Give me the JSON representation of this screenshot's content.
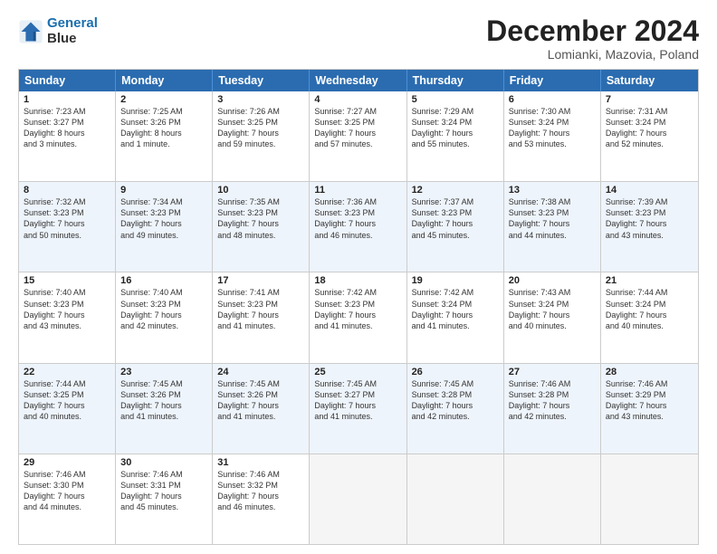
{
  "logo": {
    "line1": "General",
    "line2": "Blue"
  },
  "title": "December 2024",
  "location": "Lomianki, Mazovia, Poland",
  "days": [
    "Sunday",
    "Monday",
    "Tuesday",
    "Wednesday",
    "Thursday",
    "Friday",
    "Saturday"
  ],
  "rows": [
    [
      {
        "day": "1",
        "text": "Sunrise: 7:23 AM\nSunset: 3:27 PM\nDaylight: 8 hours\nand 3 minutes."
      },
      {
        "day": "2",
        "text": "Sunrise: 7:25 AM\nSunset: 3:26 PM\nDaylight: 8 hours\nand 1 minute."
      },
      {
        "day": "3",
        "text": "Sunrise: 7:26 AM\nSunset: 3:25 PM\nDaylight: 7 hours\nand 59 minutes."
      },
      {
        "day": "4",
        "text": "Sunrise: 7:27 AM\nSunset: 3:25 PM\nDaylight: 7 hours\nand 57 minutes."
      },
      {
        "day": "5",
        "text": "Sunrise: 7:29 AM\nSunset: 3:24 PM\nDaylight: 7 hours\nand 55 minutes."
      },
      {
        "day": "6",
        "text": "Sunrise: 7:30 AM\nSunset: 3:24 PM\nDaylight: 7 hours\nand 53 minutes."
      },
      {
        "day": "7",
        "text": "Sunrise: 7:31 AM\nSunset: 3:24 PM\nDaylight: 7 hours\nand 52 minutes."
      }
    ],
    [
      {
        "day": "8",
        "text": "Sunrise: 7:32 AM\nSunset: 3:23 PM\nDaylight: 7 hours\nand 50 minutes."
      },
      {
        "day": "9",
        "text": "Sunrise: 7:34 AM\nSunset: 3:23 PM\nDaylight: 7 hours\nand 49 minutes."
      },
      {
        "day": "10",
        "text": "Sunrise: 7:35 AM\nSunset: 3:23 PM\nDaylight: 7 hours\nand 48 minutes."
      },
      {
        "day": "11",
        "text": "Sunrise: 7:36 AM\nSunset: 3:23 PM\nDaylight: 7 hours\nand 46 minutes."
      },
      {
        "day": "12",
        "text": "Sunrise: 7:37 AM\nSunset: 3:23 PM\nDaylight: 7 hours\nand 45 minutes."
      },
      {
        "day": "13",
        "text": "Sunrise: 7:38 AM\nSunset: 3:23 PM\nDaylight: 7 hours\nand 44 minutes."
      },
      {
        "day": "14",
        "text": "Sunrise: 7:39 AM\nSunset: 3:23 PM\nDaylight: 7 hours\nand 43 minutes."
      }
    ],
    [
      {
        "day": "15",
        "text": "Sunrise: 7:40 AM\nSunset: 3:23 PM\nDaylight: 7 hours\nand 43 minutes."
      },
      {
        "day": "16",
        "text": "Sunrise: 7:40 AM\nSunset: 3:23 PM\nDaylight: 7 hours\nand 42 minutes."
      },
      {
        "day": "17",
        "text": "Sunrise: 7:41 AM\nSunset: 3:23 PM\nDaylight: 7 hours\nand 41 minutes."
      },
      {
        "day": "18",
        "text": "Sunrise: 7:42 AM\nSunset: 3:23 PM\nDaylight: 7 hours\nand 41 minutes."
      },
      {
        "day": "19",
        "text": "Sunrise: 7:42 AM\nSunset: 3:24 PM\nDaylight: 7 hours\nand 41 minutes."
      },
      {
        "day": "20",
        "text": "Sunrise: 7:43 AM\nSunset: 3:24 PM\nDaylight: 7 hours\nand 40 minutes."
      },
      {
        "day": "21",
        "text": "Sunrise: 7:44 AM\nSunset: 3:24 PM\nDaylight: 7 hours\nand 40 minutes."
      }
    ],
    [
      {
        "day": "22",
        "text": "Sunrise: 7:44 AM\nSunset: 3:25 PM\nDaylight: 7 hours\nand 40 minutes."
      },
      {
        "day": "23",
        "text": "Sunrise: 7:45 AM\nSunset: 3:26 PM\nDaylight: 7 hours\nand 41 minutes."
      },
      {
        "day": "24",
        "text": "Sunrise: 7:45 AM\nSunset: 3:26 PM\nDaylight: 7 hours\nand 41 minutes."
      },
      {
        "day": "25",
        "text": "Sunrise: 7:45 AM\nSunset: 3:27 PM\nDaylight: 7 hours\nand 41 minutes."
      },
      {
        "day": "26",
        "text": "Sunrise: 7:45 AM\nSunset: 3:28 PM\nDaylight: 7 hours\nand 42 minutes."
      },
      {
        "day": "27",
        "text": "Sunrise: 7:46 AM\nSunset: 3:28 PM\nDaylight: 7 hours\nand 42 minutes."
      },
      {
        "day": "28",
        "text": "Sunrise: 7:46 AM\nSunset: 3:29 PM\nDaylight: 7 hours\nand 43 minutes."
      }
    ],
    [
      {
        "day": "29",
        "text": "Sunrise: 7:46 AM\nSunset: 3:30 PM\nDaylight: 7 hours\nand 44 minutes."
      },
      {
        "day": "30",
        "text": "Sunrise: 7:46 AM\nSunset: 3:31 PM\nDaylight: 7 hours\nand 45 minutes."
      },
      {
        "day": "31",
        "text": "Sunrise: 7:46 AM\nSunset: 3:32 PM\nDaylight: 7 hours\nand 46 minutes."
      },
      {
        "day": "",
        "text": ""
      },
      {
        "day": "",
        "text": ""
      },
      {
        "day": "",
        "text": ""
      },
      {
        "day": "",
        "text": ""
      }
    ]
  ]
}
